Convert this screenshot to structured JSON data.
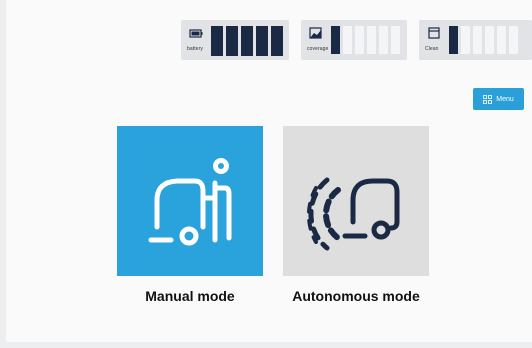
{
  "status_bar": {
    "battery": {
      "label": "battery",
      "icon": "battery-icon",
      "level_segments": 5,
      "total_segments": 5
    },
    "coverage": {
      "label": "coverage",
      "icon": "map-icon",
      "level_segments": 1,
      "total_segments": 6
    },
    "clean": {
      "label": "Clean",
      "icon": "bin-icon",
      "level_segments": 1,
      "total_segments": 6
    }
  },
  "menu": {
    "label": "Menu",
    "icon": "grid-icon"
  },
  "modes": [
    {
      "label": "Manual mode",
      "icon": "operator-with-cleaning-machine-icon",
      "color": "#2aa3dc"
    },
    {
      "label": "Autonomous mode",
      "icon": "autonomous-machine-with-sensor-waves-icon",
      "color": "#dedede"
    }
  ],
  "colors": {
    "accent": "#2aa3dc",
    "segment_on": "#1b2a44",
    "segment_off": "#f4f5f7"
  }
}
